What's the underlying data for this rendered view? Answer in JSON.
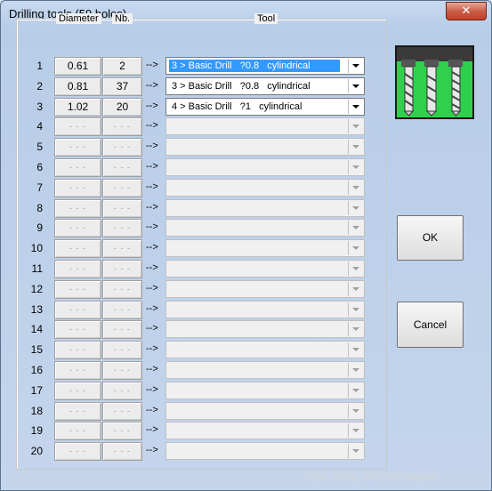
{
  "window": {
    "title": "Drilling tools (59 holes)",
    "close_symbol": "✕"
  },
  "headers": {
    "diameter": "Diameter",
    "nb": "Nb.",
    "tool": "Tool"
  },
  "arrow": "-->",
  "rows": [
    {
      "num": "1",
      "diameter": "0.61",
      "nb": "2",
      "tool": "3 > Basic Drill   ?0.8   cylindrical"
    },
    {
      "num": "2",
      "diameter": "0.81",
      "nb": "37",
      "tool": "3 > Basic Drill   ?0.8   cylindrical"
    },
    {
      "num": "3",
      "diameter": "1.02",
      "nb": "20",
      "tool": "4 > Basic Drill   ?1   cylindrical"
    },
    {
      "num": "4",
      "diameter": "- - -",
      "nb": "- - -",
      "tool": ""
    },
    {
      "num": "5",
      "diameter": "- - -",
      "nb": "- - -",
      "tool": ""
    },
    {
      "num": "6",
      "diameter": "- - -",
      "nb": "- - -",
      "tool": ""
    },
    {
      "num": "7",
      "diameter": "- - -",
      "nb": "- - -",
      "tool": ""
    },
    {
      "num": "8",
      "diameter": "- - -",
      "nb": "- - -",
      "tool": ""
    },
    {
      "num": "9",
      "diameter": "- - -",
      "nb": "- - -",
      "tool": ""
    },
    {
      "num": "10",
      "diameter": "- - -",
      "nb": "- - -",
      "tool": ""
    },
    {
      "num": "11",
      "diameter": "- - -",
      "nb": "- - -",
      "tool": ""
    },
    {
      "num": "12",
      "diameter": "- - -",
      "nb": "- - -",
      "tool": ""
    },
    {
      "num": "13",
      "diameter": "- - -",
      "nb": "- - -",
      "tool": ""
    },
    {
      "num": "14",
      "diameter": "- - -",
      "nb": "- - -",
      "tool": ""
    },
    {
      "num": "15",
      "diameter": "- - -",
      "nb": "- - -",
      "tool": ""
    },
    {
      "num": "16",
      "diameter": "- - -",
      "nb": "- - -",
      "tool": ""
    },
    {
      "num": "17",
      "diameter": "- - -",
      "nb": "- - -",
      "tool": ""
    },
    {
      "num": "18",
      "diameter": "- - -",
      "nb": "- - -",
      "tool": ""
    },
    {
      "num": "19",
      "diameter": "- - -",
      "nb": "- - -",
      "tool": ""
    },
    {
      "num": "20",
      "diameter": "- - -",
      "nb": "- - -",
      "tool": ""
    }
  ],
  "buttons": {
    "ok": "OK",
    "cancel": "Cancel"
  },
  "icons": {
    "logo": "drill-bits-icon",
    "dropdown": "chevron-down-icon"
  },
  "watermark": "https://blog.csdn.net/haigear",
  "colors": {
    "selection": "#3399ff",
    "logo_bg": "#2fd04c",
    "close": "#c43d24"
  }
}
